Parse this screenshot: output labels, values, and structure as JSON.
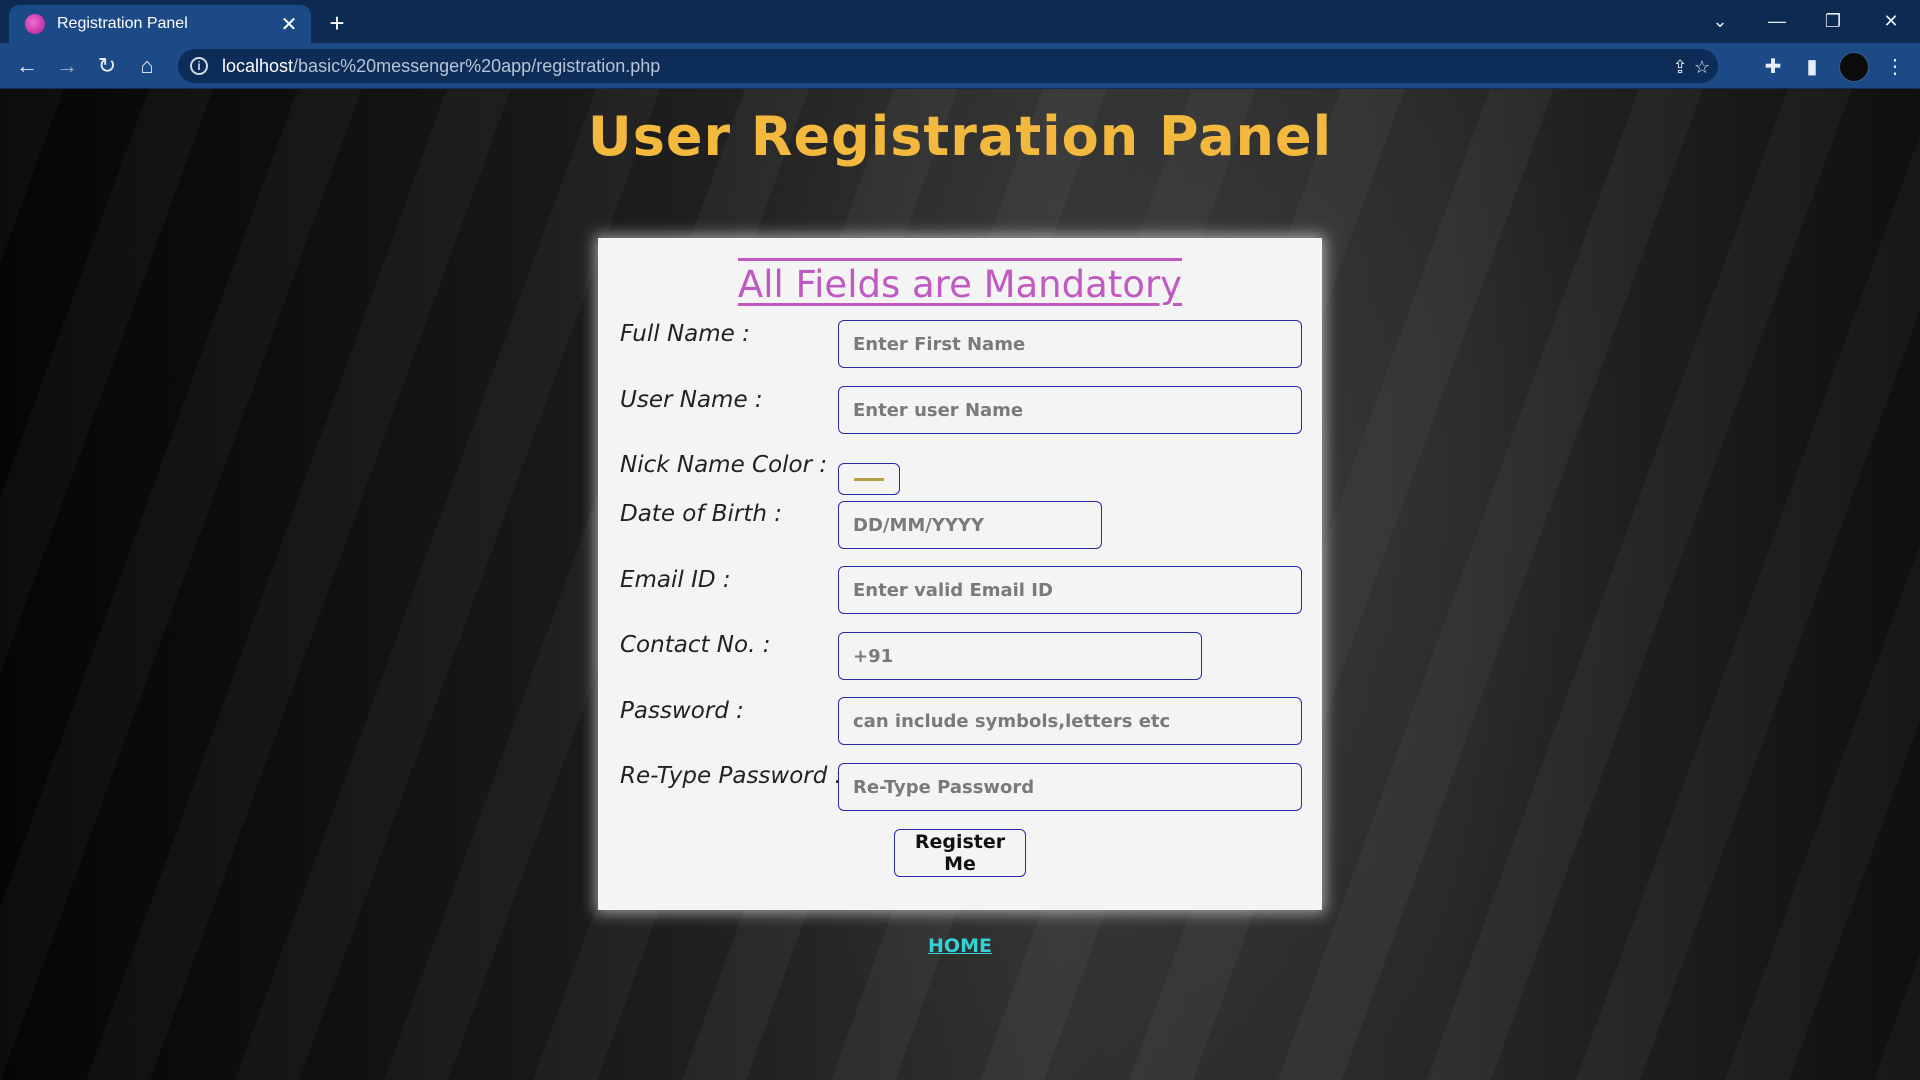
{
  "browser": {
    "tab_title": "Registration Panel",
    "url_host": "localhost",
    "url_path": "/basic%20messenger%20app/registration.php"
  },
  "page": {
    "title": "User Registration Panel",
    "card_heading": "All Fields are Mandatory",
    "fields": {
      "full_name": {
        "label": "Full Name :",
        "placeholder": "Enter First Name"
      },
      "user_name": {
        "label": "User Name :",
        "placeholder": "Enter user Name"
      },
      "nick_color": {
        "label": "Nick Name Color :",
        "value": "#b8a040"
      },
      "dob": {
        "label": "Date of Birth :",
        "placeholder": "DD/MM/YYYY"
      },
      "email": {
        "label": "Email ID :",
        "placeholder": "Enter valid Email ID"
      },
      "contact": {
        "label": "Contact No. :",
        "placeholder": "+91"
      },
      "password": {
        "label": "Password :",
        "placeholder": "can include symbols,letters etc"
      },
      "retype_password": {
        "label": "Re-Type Password :",
        "placeholder": "Re-Type Password"
      }
    },
    "register_button": "Register Me",
    "home_link": "HOME"
  },
  "colors": {
    "title": "#f3b93e",
    "heading": "#c05ac2",
    "field_border": "#2a2aa8",
    "home_link": "#34d2d2",
    "chrome_tabbar": "#0c2a52",
    "chrome_toolbar": "#1c4a86"
  },
  "icons": {
    "favicon": "favicon-icon",
    "back": "back-arrow-icon",
    "forward": "forward-arrow-icon",
    "reload": "reload-icon",
    "home": "home-icon",
    "site_info": "info-icon",
    "share": "share-icon",
    "bookmark": "star-icon",
    "extensions": "puzzle-icon",
    "side_panel": "side-panel-icon",
    "menu": "kebab-menu-icon"
  }
}
